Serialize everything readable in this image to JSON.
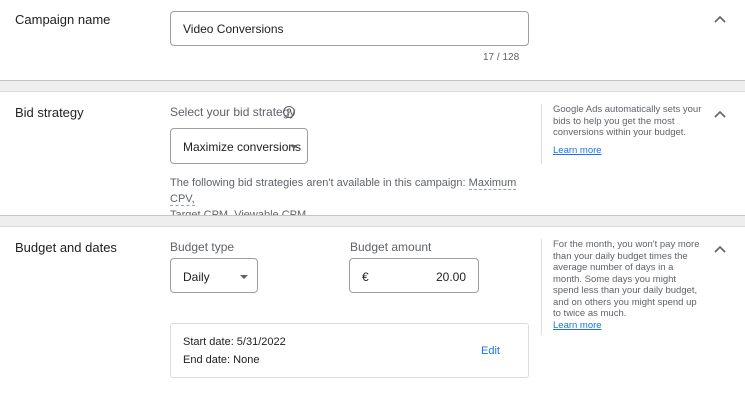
{
  "campaign_name": {
    "title": "Campaign name",
    "value": "Video Conversions",
    "counter": "17 / 128"
  },
  "bid_strategy": {
    "title": "Bid strategy",
    "select_label": "Select your bid strategy",
    "selected": "Maximize conversions",
    "note_prefix": "The following bid strategies aren't available in this campaign:",
    "unavailable": [
      "Maximum CPV,",
      "Target CPM,",
      "Viewable CPM"
    ],
    "help_text": "Google Ads automatically sets your bids to help you get the most conversions within your budget.",
    "help_link": "Learn more"
  },
  "budget_dates": {
    "title": "Budget and dates",
    "budget_type_label": "Budget type",
    "budget_type_value": "Daily",
    "budget_amount_label": "Budget amount",
    "currency_symbol": "€",
    "amount": "20.00",
    "start_date": "Start date: 5/31/2022",
    "end_date": "End date: None",
    "edit_label": "Edit",
    "help_text": "For the month, you won't pay more than your daily budget times the average number of days in a month. Some days you might spend less than your daily budget, and on others you might spend up to twice as much.",
    "help_link": "Learn more"
  },
  "icons": [
    "chevron-up-icon",
    "help-circle-icon",
    "dropdown-arrow-icon"
  ],
  "colors": {
    "link": "#1a73e8",
    "divider": "#eeeeee",
    "border": "#9aa0a6"
  }
}
